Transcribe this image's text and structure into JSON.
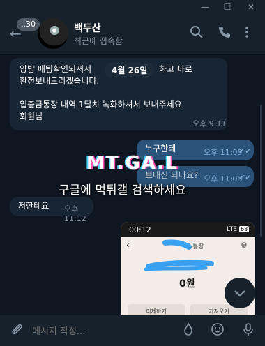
{
  "window": {
    "minimize": "—",
    "maximize": "☐",
    "close": "✕"
  },
  "header": {
    "back": "←",
    "unread_badge": "..30",
    "title": "백두산",
    "status": "최근에 접속함"
  },
  "date_pill": "4월 26일",
  "messages": [
    {
      "dir": "in",
      "text": "양방 배팅확인되셔서 \n환전보내드리겠습니다.\n\n입출금통장 내역 1달치 녹화하셔서 보내주세요\n회원님",
      "time": "오후 9:11"
    },
    {
      "dir": "out",
      "text": "누구한테",
      "time": "오후 11:09",
      "check": "✔✔"
    },
    {
      "dir": "out",
      "text": "보내신 되나요?",
      "time": "오후 11:09",
      "check": "✔✔"
    },
    {
      "dir": "in",
      "text": "저한테요",
      "time": "오후 11:12"
    }
  ],
  "msg1_tail": "하고 바로",
  "watermark": {
    "logo": "MT.GA.L",
    "text": "구글에 먹튀갤 검색하세요"
  },
  "screenshot": {
    "clock": "00:12",
    "status": "LTE",
    "battery": "68",
    "account_suffix": "의 통장",
    "balance": "0원",
    "btn_transfer": "이체하기",
    "btn_bring": "가져오기"
  },
  "input": {
    "placeholder": "메시지 작성..."
  },
  "colors": {
    "bg": "#0e1621",
    "bubble_in": "#182533",
    "bubble_out": "#2b5278",
    "accent": "#7da8d3"
  }
}
